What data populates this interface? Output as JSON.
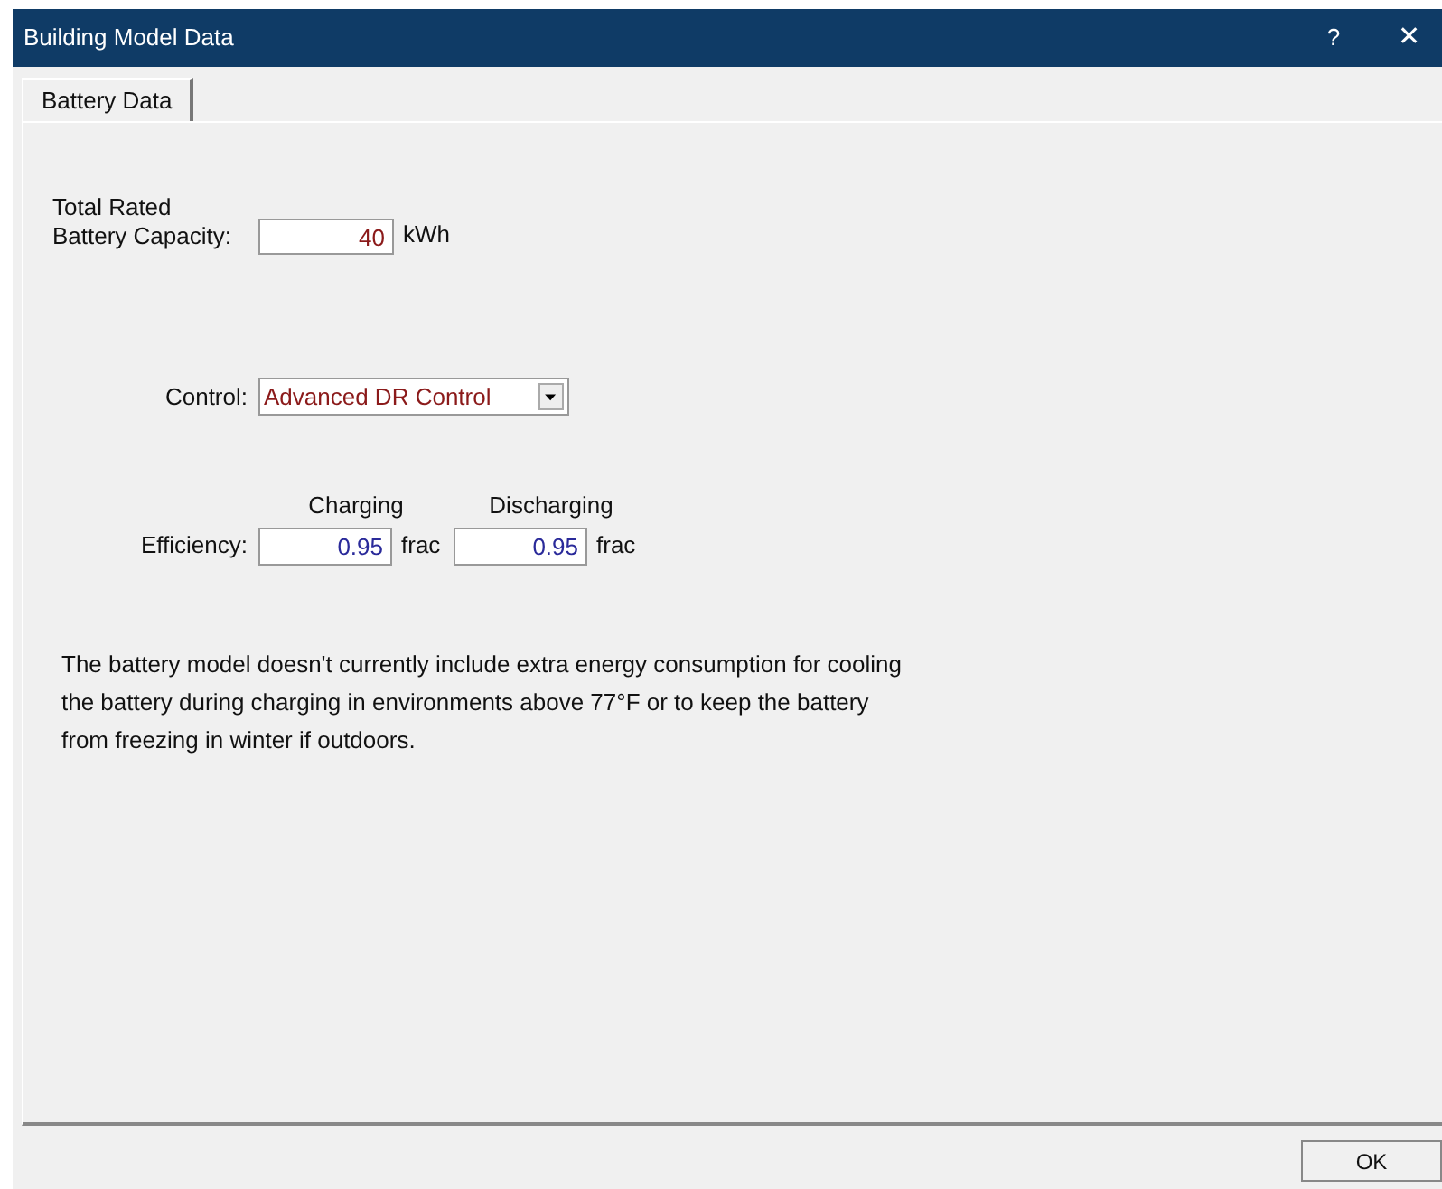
{
  "window": {
    "title": "Building Model Data",
    "help": "?",
    "close": "✕"
  },
  "tabs": [
    {
      "label": "Battery Data",
      "selected": true
    }
  ],
  "capacity": {
    "label_line1": "Total Rated",
    "label_line2": "Battery Capacity:",
    "value": "40",
    "unit": "kWh"
  },
  "control": {
    "label": "Control:",
    "value": "Advanced DR Control"
  },
  "efficiency": {
    "label": "Efficiency:",
    "columns": [
      {
        "heading": "Charging",
        "value": "0.95",
        "unit": "frac"
      },
      {
        "heading": "Discharging",
        "value": "0.95",
        "unit": "frac"
      }
    ]
  },
  "note": "The battery model doesn't currently include extra energy consumption for cooling the battery during charging in environments above 77°F or to keep the battery from freezing in winter if outdoors.",
  "buttons": [
    "OK"
  ]
}
